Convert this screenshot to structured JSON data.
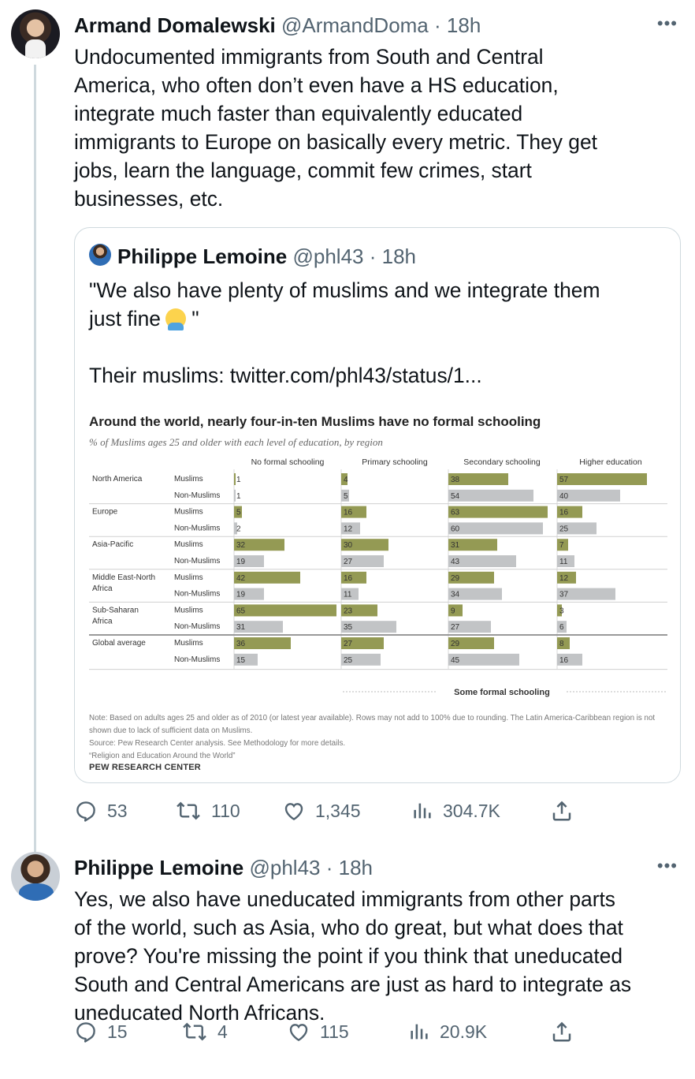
{
  "tweet1": {
    "author_name": "Armand Domalewski",
    "handle": "@ArmandDoma",
    "separator": "·",
    "time": "18h",
    "more": "•••",
    "text": "Undocumented immigrants from South and Central\nAmerica, who often don’t even have a HS education,\nintegrate much faster than equivalently educated\nimmigrants to Europe on basically every metric. They get\njobs, learn the language, commit few crimes, start\nbusinesses, etc.",
    "quote": {
      "author_name": "Philippe Lemoine",
      "handle": "@phl43",
      "separator": "·",
      "time": "18h",
      "text_line1": "\"We also have plenty of muslims and we integrate them\njust fine",
      "text_line1_end": " \"",
      "text_line2": "Their muslims:  twitter.com/phl43/status/1...",
      "emoji": "person-shrugging"
    },
    "stats": {
      "replies": "53",
      "retweets": "110",
      "likes": "1,345",
      "views": "304.7K"
    }
  },
  "pew": {
    "title": "Around the world, nearly four-in-ten Muslims have no formal schooling",
    "subtitle": "% of Muslims ages 25 and older with each level of education, by region",
    "note": "Note: Based on adults ages 25 and older as of 2010 (or latest year available). Rows may not add to 100% due to rounding. The Latin America-Caribbean region is not shown due to lack of sufficient data on Muslims.\nSource: Pew Research Center analysis. See Methodology for more details.\n“Religion and Education Around the World”",
    "brand": "PEW RESEARCH CENTER",
    "colors": {
      "muslims": "#949a54",
      "non_muslims": "#c2c4c6"
    }
  },
  "chart_data": {
    "type": "bar",
    "title": "Around the world, nearly four-in-ten Muslims have no formal schooling",
    "subtitle": "% of Muslims ages 25 and older with each level of education, by region",
    "columns": [
      "No formal schooling",
      "Primary schooling",
      "Secondary schooling",
      "Higher education"
    ],
    "column_group_label": "Some formal schooling",
    "rows": [
      {
        "region": "North America",
        "group": "Muslims",
        "values": [
          1,
          4,
          38,
          57
        ]
      },
      {
        "region": "",
        "group": "Non-Muslims",
        "values": [
          1,
          5,
          54,
          40
        ]
      },
      {
        "region": "Europe",
        "group": "Muslims",
        "values": [
          5,
          16,
          63,
          16
        ]
      },
      {
        "region": "",
        "group": "Non-Muslims",
        "values": [
          2,
          12,
          60,
          25
        ]
      },
      {
        "region": "Asia-Pacific",
        "group": "Muslims",
        "values": [
          32,
          30,
          31,
          7
        ]
      },
      {
        "region": "",
        "group": "Non-Muslims",
        "values": [
          19,
          27,
          43,
          11
        ]
      },
      {
        "region": "Middle East-North\nAfrica",
        "group": "Muslims",
        "values": [
          42,
          16,
          29,
          12
        ]
      },
      {
        "region": "",
        "group": "Non-Muslims",
        "values": [
          19,
          11,
          34,
          37
        ]
      },
      {
        "region": "Sub-Saharan\nAfrica",
        "group": "Muslims",
        "values": [
          65,
          23,
          9,
          3
        ]
      },
      {
        "region": "",
        "group": "Non-Muslims",
        "values": [
          31,
          35,
          27,
          6
        ]
      },
      {
        "region": "Global average",
        "group": "Muslims",
        "values": [
          36,
          27,
          29,
          8
        ]
      },
      {
        "region": "",
        "group": "Non-Muslims",
        "values": [
          15,
          25,
          45,
          16
        ]
      }
    ]
  },
  "tweet2": {
    "author_name": "Philippe Lemoine",
    "handle": "@phl43",
    "separator": "·",
    "time": "18h",
    "more": "•••",
    "text": "Yes, we also have uneducated immigrants from other parts\nof the world, such as Asia, who do great, but what does that\nprove? You're missing the point if you think that uneducated\nSouth and Central Americans are just as hard to integrate as\nuneducated North Africans.",
    "stats": {
      "replies": "15",
      "retweets": "4",
      "likes": "115",
      "views": "20.9K"
    }
  }
}
